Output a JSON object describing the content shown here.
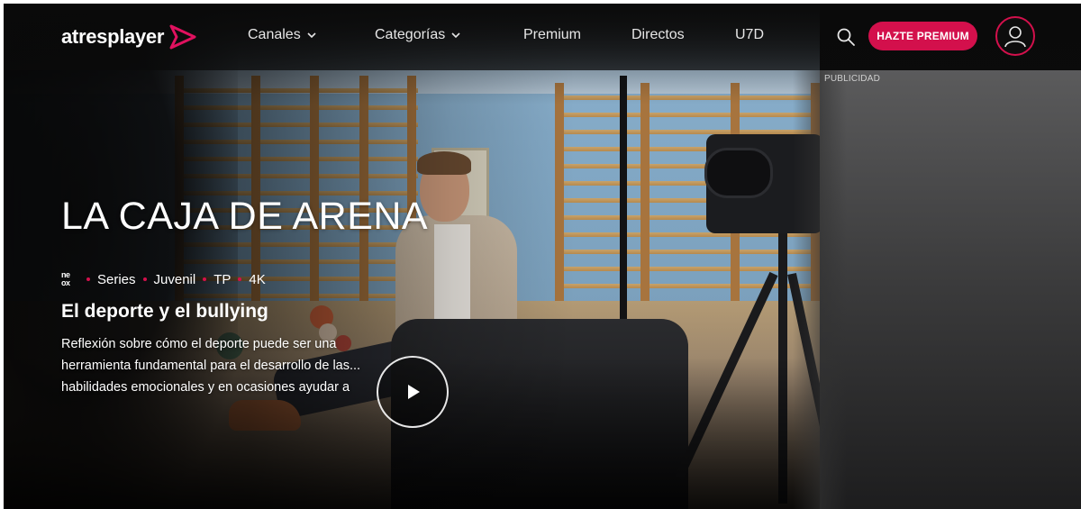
{
  "header": {
    "logo_text": "atresplayer",
    "nav": [
      {
        "label": "Canales",
        "has_dropdown": true
      },
      {
        "label": "Categorías",
        "has_dropdown": true
      },
      {
        "label": "Premium",
        "has_dropdown": false
      },
      {
        "label": "Directos",
        "has_dropdown": false
      },
      {
        "label": "U7D",
        "has_dropdown": false
      }
    ],
    "search_icon": "search-icon",
    "premium_button": "HAZTE PREMIUM",
    "avatar_icon": "user-icon"
  },
  "hero": {
    "title": "LA CAJA DE ARENA",
    "channel_logo_top": "ne",
    "channel_logo_bottom": "ox",
    "tags": [
      "Series",
      "Juvenil",
      "TP",
      "4K"
    ],
    "episode_title": "El deporte y el bullying",
    "synopsis_lines": [
      "Reflexión sobre cómo el deporte puede ser una",
      "herramienta fundamental para el desarrollo de las...",
      "habilidades emocionales y en ocasiones ayudar a"
    ],
    "play_icon": "play-icon"
  },
  "ad": {
    "label": "PUBLICIDAD"
  },
  "colors": {
    "brand": "#d3104c",
    "background": "#0d0d0d",
    "text": "#ffffff"
  }
}
